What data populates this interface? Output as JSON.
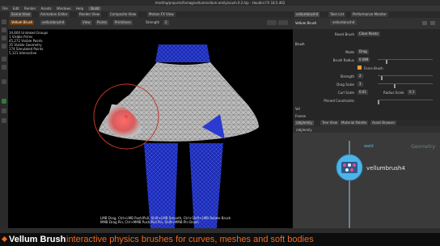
{
  "window": {
    "title": "/mnt/hq/projects/fxmag/vellum/vellum.emily.brush.0.2.hip - Houdini FX 18.5.462"
  },
  "menu": {
    "items": [
      "File",
      "Edit",
      "Render",
      "Assets",
      "Windows",
      "Help"
    ],
    "desktop": "Build"
  },
  "viewer": {
    "tabs": [
      "Scene View",
      "Animation Editor",
      "Render View",
      "Composite View",
      "Motion FX View"
    ],
    "toolbar": {
      "mode": "Vellum Brush",
      "op_name": "vellumbrush4",
      "controls": [
        "View",
        "Points",
        "Primitives"
      ],
      "strength_label": "Strength",
      "strength_value": "2"
    },
    "info_lines": [
      "34,600 Unlinked Groups",
      "1 Visible Prims",
      "45,272 Visible Points",
      "35 Visible Geometry",
      "174 Simulated Points",
      "5,121 Interactive"
    ],
    "hint_lines": [
      "LMB Drag, Ctrl+LMB Push/Pull, Shift+LMB Smooth, Ctrl+Shift+LMB Rotate Brush",
      "MMB Drag Pin, Ctrl+MMB Push/Pull Pin, Shift+MMB Pin Brush"
    ]
  },
  "params": {
    "tabs": [
      "vellumbrush4",
      "Take List",
      "Performance Monitor"
    ],
    "node_type": "Vellum Brush",
    "node_name": "vellumbrush4",
    "rows": [
      {
        "label": "Reset Brush",
        "value": "Clear Points"
      },
      {
        "label": "Brush",
        "value": ""
      },
      {
        "label": "Mode",
        "value": "Drag"
      },
      {
        "label": "Brush Radius",
        "value": "0.089"
      },
      {
        "label": "Force Brush",
        "value": ""
      },
      {
        "label": "Strength",
        "value": "2"
      },
      {
        "label": "Drag Scale",
        "value": "1"
      },
      {
        "label": "Curl Scale",
        "value": "0.01"
      },
      {
        "label": "Radius Scale",
        "value": "0.1"
      },
      {
        "label": "Pinned Constraints",
        "value": ""
      },
      {
        "label": "Vel",
        "value": ""
      },
      {
        "label": "Freeze",
        "value": ""
      }
    ]
  },
  "network": {
    "tabs": [
      "/obj/emily",
      "Tree View",
      "Material Palette",
      "Asset Browser"
    ],
    "path": "/obj/emily",
    "context_label": "Geometry",
    "node_above": "weld",
    "node_label": "vellumbrush4"
  },
  "caption": {
    "title": "Vellum Brush",
    "description": "interactive physics brushes for curves, meshes and soft bodies"
  },
  "colors": {
    "accent": "#f26a1b",
    "node_color": "#4fb3e8",
    "wireframe": "#2a3bcf",
    "skirt": "#bdbdbd",
    "brush_ring": "#c0392b"
  }
}
